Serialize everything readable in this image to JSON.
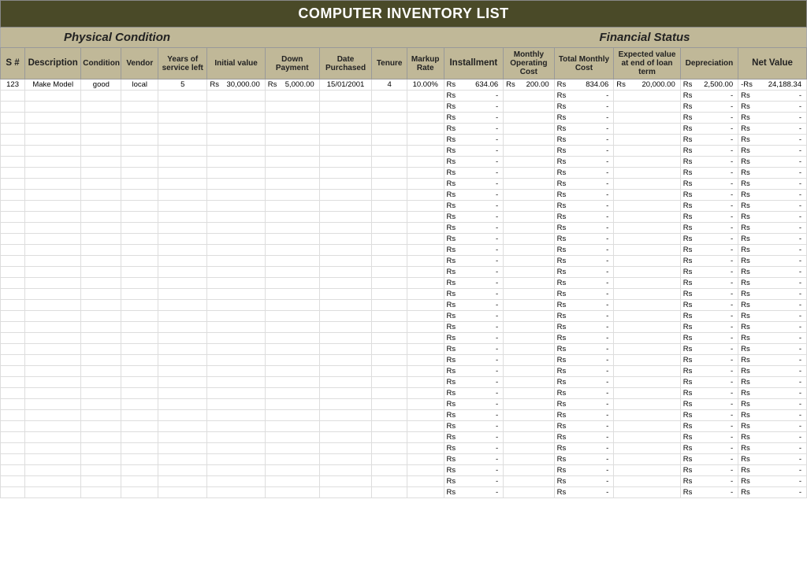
{
  "title": "COMPUTER INVENTORY LIST",
  "sections": {
    "physical": "Physical Condition",
    "financial": "Financial Status"
  },
  "headers": {
    "sn": "S #",
    "desc": "Description",
    "cond": "Condition",
    "vend": "Vendor",
    "serv": "Years of service left",
    "init": "Initial value",
    "down": "Down Payment",
    "date": "Date Purchased",
    "ten": "Tenure",
    "mark": "Markup Rate",
    "inst": "Installment",
    "moc": "Monthly Operating Cost",
    "tmc": "Total Monthly Cost",
    "exp": "Expected value at end of loan term",
    "dep": "Depreciation",
    "net": "Net Value"
  },
  "currency": "Rs",
  "dash": "-",
  "emptyRowCount": 37,
  "dataRow": {
    "sn": "123",
    "desc": "Make Model",
    "cond": "good",
    "vend": "local",
    "serv": "5",
    "init": "30,000.00",
    "down": "5,000.00",
    "date": "15/01/2001",
    "ten": "4",
    "mark": "10.00%",
    "inst": "634.06",
    "moc": "200.00",
    "tmc": "834.06",
    "exp": "20,000.00",
    "dep": "2,500.00",
    "net": "24,188.34",
    "net_neg": true
  }
}
